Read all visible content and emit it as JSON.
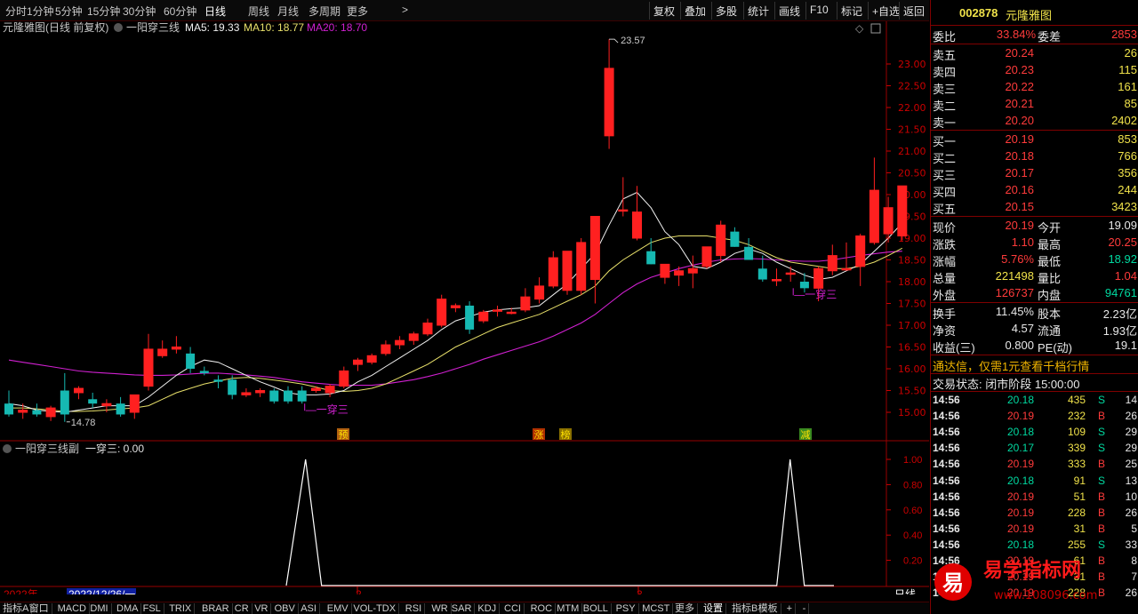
{
  "toolbar": {
    "periods": [
      "分时",
      "1分钟",
      "5分钟",
      "15分钟",
      "30分钟",
      "60分钟",
      "日线",
      "周线",
      "月线",
      "多周期",
      "更多"
    ],
    "active_period": "日线",
    "right_buttons": [
      "复权",
      "叠加",
      "多股",
      "统计",
      "画线",
      "F10",
      "标记",
      "+自选",
      "返回"
    ]
  },
  "main_header": {
    "title": "元隆雅图(日线 前复权)",
    "indicator": "一阳穿三线",
    "ma5": "MA5: 19.33",
    "ma10": "MA10: 18.77",
    "ma20": "MA20: 18.70"
  },
  "sub_header": {
    "title": "一阳穿三线副",
    "value": "一穿三: 0.00"
  },
  "chart_data": {
    "type": "candlestick",
    "y_axis_ticks": [
      "23.00",
      "22.50",
      "22.00",
      "21.50",
      "21.00",
      "20.50",
      "20.00",
      "19.50",
      "19.00",
      "18.50",
      "18.00",
      "17.50",
      "17.00",
      "16.50",
      "16.00",
      "15.50",
      "15.00"
    ],
    "ylim": [
      14.6,
      24.0
    ],
    "candles": [
      [
        15.2,
        15.5,
        14.9,
        14.95
      ],
      [
        15.0,
        15.2,
        14.85,
        15.05
      ],
      [
        15.05,
        15.2,
        14.9,
        14.95
      ],
      [
        14.9,
        15.15,
        14.8,
        15.1
      ],
      [
        15.5,
        15.9,
        14.78,
        14.95
      ],
      [
        15.45,
        15.6,
        15.3,
        15.55
      ],
      [
        15.3,
        15.45,
        15.1,
        15.2
      ],
      [
        15.15,
        15.3,
        15.0,
        15.2
      ],
      [
        15.2,
        15.35,
        14.9,
        14.95
      ],
      [
        15.0,
        15.3,
        14.85,
        15.4
      ],
      [
        15.6,
        16.8,
        15.5,
        16.45
      ],
      [
        16.3,
        16.65,
        16.25,
        16.45
      ],
      [
        16.45,
        16.75,
        16.35,
        16.5
      ],
      [
        16.35,
        16.5,
        15.9,
        16.0
      ],
      [
        15.95,
        16.05,
        15.85,
        15.9
      ],
      [
        15.75,
        15.85,
        15.55,
        15.7
      ],
      [
        15.75,
        15.85,
        15.3,
        15.4
      ],
      [
        15.4,
        15.55,
        15.35,
        15.45
      ],
      [
        15.45,
        15.55,
        15.35,
        15.5
      ],
      [
        15.5,
        15.55,
        15.2,
        15.25
      ],
      [
        15.5,
        15.6,
        15.2,
        15.25
      ],
      [
        15.5,
        15.6,
        15.2,
        15.25
      ],
      [
        15.5,
        15.6,
        15.45,
        15.55
      ],
      [
        15.45,
        15.65,
        15.35,
        15.6
      ],
      [
        15.6,
        16.05,
        15.55,
        15.95
      ],
      [
        16.1,
        16.25,
        15.95,
        16.2
      ],
      [
        16.15,
        16.35,
        16.1,
        16.3
      ],
      [
        16.35,
        16.65,
        16.3,
        16.55
      ],
      [
        16.55,
        16.75,
        16.45,
        16.65
      ],
      [
        16.65,
        16.85,
        16.55,
        16.8
      ],
      [
        16.8,
        17.15,
        16.75,
        17.05
      ],
      [
        17.0,
        17.7,
        16.95,
        17.6
      ],
      [
        17.4,
        17.5,
        17.3,
        17.45
      ],
      [
        17.45,
        17.55,
        16.8,
        16.9
      ],
      [
        17.1,
        17.35,
        17.05,
        17.3
      ],
      [
        17.35,
        17.45,
        17.2,
        17.35
      ],
      [
        17.3,
        17.4,
        17.25,
        17.3
      ],
      [
        17.35,
        17.85,
        17.3,
        17.65
      ],
      [
        17.6,
        18.1,
        17.5,
        17.9
      ],
      [
        17.9,
        18.7,
        17.85,
        18.55
      ],
      [
        17.8,
        18.7,
        17.7,
        18.7
      ],
      [
        17.8,
        19.0,
        17.7,
        18.9
      ],
      [
        18.05,
        19.5,
        17.5,
        19.5
      ],
      [
        21.35,
        23.57,
        21.05,
        22.9
      ],
      [
        19.65,
        20.4,
        19.5,
        19.65
      ],
      [
        19.0,
        20.2,
        18.95,
        19.6
      ],
      [
        18.7,
        19.0,
        18.4,
        18.4
      ],
      [
        18.1,
        18.35,
        17.95,
        18.4
      ],
      [
        18.15,
        18.35,
        17.9,
        18.25
      ],
      [
        18.2,
        18.6,
        17.85,
        18.3
      ],
      [
        18.35,
        18.8,
        18.3,
        18.8
      ],
      [
        18.6,
        19.4,
        18.45,
        19.3
      ],
      [
        19.15,
        19.25,
        18.8,
        18.8
      ],
      [
        18.8,
        19.0,
        18.55,
        18.5
      ],
      [
        18.3,
        18.6,
        18.0,
        18.05
      ],
      [
        18.05,
        18.3,
        17.9,
        18.05
      ],
      [
        18.2,
        18.35,
        18.0,
        18.2
      ],
      [
        18.0,
        18.2,
        17.75,
        17.85
      ],
      [
        17.85,
        18.35,
        17.55,
        18.3
      ],
      [
        18.25,
        18.85,
        18.15,
        18.6
      ],
      [
        18.3,
        18.9,
        18.25,
        18.3
      ],
      [
        18.35,
        19.1,
        17.9,
        19.05
      ],
      [
        18.9,
        20.85,
        18.85,
        20.1
      ],
      [
        19.1,
        19.95,
        18.9,
        19.7
      ],
      [
        19.05,
        20.2,
        18.95,
        20.2
      ]
    ],
    "candle_x_start": 10,
    "candle_x_step": 15.7,
    "ma5": [
      15.2,
      15.15,
      15.05,
      15.02,
      15.0,
      15.05,
      15.1,
      15.15,
      15.15,
      15.15,
      15.35,
      15.6,
      15.85,
      16.05,
      16.2,
      16.15,
      16.0,
      15.85,
      15.7,
      15.58,
      15.45,
      15.4,
      15.4,
      15.42,
      15.5,
      15.7,
      15.85,
      16.05,
      16.25,
      16.45,
      16.65,
      16.9,
      17.1,
      17.2,
      17.3,
      17.35,
      17.38,
      17.4,
      17.45,
      17.7,
      17.95,
      18.3,
      18.65,
      19.3,
      19.9,
      20.05,
      19.7,
      19.15,
      18.85,
      18.35,
      18.3,
      18.45,
      18.65,
      18.75,
      18.65,
      18.45,
      18.3,
      18.15,
      18.05,
      18.1,
      18.25,
      18.4,
      18.7,
      19.0,
      19.35
    ],
    "ma10": [
      15.1,
      15.1,
      15.08,
      15.05,
      15.02,
      15.02,
      15.03,
      15.05,
      15.08,
      15.1,
      15.15,
      15.3,
      15.45,
      15.55,
      15.65,
      15.72,
      15.78,
      15.8,
      15.78,
      15.74,
      15.7,
      15.65,
      15.58,
      15.5,
      15.48,
      15.5,
      15.55,
      15.65,
      15.8,
      15.95,
      16.1,
      16.3,
      16.5,
      16.65,
      16.8,
      16.95,
      17.05,
      17.15,
      17.25,
      17.4,
      17.55,
      17.7,
      17.9,
      18.25,
      18.5,
      18.7,
      18.9,
      19.0,
      19.05,
      19.05,
      19.05,
      19.0,
      18.95,
      18.85,
      18.7,
      18.55,
      18.45,
      18.4,
      18.35,
      18.3,
      18.3,
      18.35,
      18.45,
      18.6,
      18.77
    ],
    "ma20": [
      16.2,
      16.15,
      16.1,
      16.05,
      16.0,
      15.95,
      15.92,
      15.9,
      15.88,
      15.86,
      15.85,
      15.85,
      15.86,
      15.88,
      15.9,
      15.9,
      15.88,
      15.86,
      15.83,
      15.8,
      15.75,
      15.7,
      15.67,
      15.64,
      15.62,
      15.62,
      15.62,
      15.65,
      15.7,
      15.75,
      15.82,
      15.9,
      16.0,
      16.1,
      16.22,
      16.32,
      16.42,
      16.52,
      16.62,
      16.75,
      16.9,
      17.05,
      17.25,
      17.5,
      17.75,
      17.95,
      18.1,
      18.2,
      18.3,
      18.38,
      18.45,
      18.5,
      18.52,
      18.53,
      18.52,
      18.5,
      18.48,
      18.47,
      18.47,
      18.5,
      18.55,
      18.6,
      18.64,
      18.68,
      18.7
    ],
    "labels": {
      "high": "23.57",
      "low": "14.78",
      "signal": "一穿三"
    },
    "markers": [
      "预",
      "涨",
      "榜",
      "减"
    ],
    "sub_ticks": [
      "1.00",
      "0.80",
      "0.60",
      "0.40",
      "0.20"
    ],
    "sub_signal_index": [
      21,
      56
    ],
    "x_axis_labels": [
      "2022年",
      "2022/12/26/一",
      "2",
      "3",
      "日线"
    ]
  },
  "quote": {
    "code": "002878",
    "name": "元隆雅图",
    "weibi_label": "委比",
    "weibi": "33.84%",
    "weicha_label": "委差",
    "weicha": "2853",
    "sells": [
      {
        "label": "卖五",
        "price": "20.24",
        "vol": "26"
      },
      {
        "label": "卖四",
        "price": "20.23",
        "vol": "115"
      },
      {
        "label": "卖三",
        "price": "20.22",
        "vol": "161"
      },
      {
        "label": "卖二",
        "price": "20.21",
        "vol": "85"
      },
      {
        "label": "卖一",
        "price": "20.20",
        "vol": "2402"
      }
    ],
    "buys": [
      {
        "label": "买一",
        "price": "20.19",
        "vol": "853"
      },
      {
        "label": "买二",
        "price": "20.18",
        "vol": "766"
      },
      {
        "label": "买三",
        "price": "20.17",
        "vol": "356"
      },
      {
        "label": "买四",
        "price": "20.16",
        "vol": "244"
      },
      {
        "label": "买五",
        "price": "20.15",
        "vol": "3423"
      }
    ],
    "stats": [
      {
        "l1": "现价",
        "v1": "20.19",
        "c1": "red",
        "l2": "今开",
        "v2": "19.09",
        "c2": "white"
      },
      {
        "l1": "涨跌",
        "v1": "1.10",
        "c1": "red",
        "l2": "最高",
        "v2": "20.25",
        "c2": "red"
      },
      {
        "l1": "涨幅",
        "v1": "5.76%",
        "c1": "red",
        "l2": "最低",
        "v2": "18.92",
        "c2": "grn"
      },
      {
        "l1": "总量",
        "v1": "221498",
        "c1": "yel",
        "l2": "量比",
        "v2": "1.04",
        "c2": "red"
      },
      {
        "l1": "外盘",
        "v1": "126737",
        "c1": "red",
        "l2": "内盘",
        "v2": "94761",
        "c2": "grn"
      }
    ],
    "stats2": [
      {
        "l1": "换手",
        "v1": "11.45%",
        "l2": "股本",
        "v2": "2.23亿"
      },
      {
        "l1": "净资",
        "v1": "4.57",
        "l2": "流通",
        "v2": "1.93亿"
      },
      {
        "l1": "收益(三)",
        "v1": "0.800",
        "l2": "PE(动)",
        "v2": "19.1"
      }
    ],
    "promo": "通达信，仅需1元查看千档行情",
    "status": "交易状态: 闭市阶段 15:00:00",
    "ticks": [
      {
        "t": "14:56",
        "p": "20.18",
        "v": "435",
        "s": "S",
        "n": "14"
      },
      {
        "t": "14:56",
        "p": "20.19",
        "v": "232",
        "s": "B",
        "n": "26"
      },
      {
        "t": "14:56",
        "p": "20.18",
        "v": "109",
        "s": "S",
        "n": "29"
      },
      {
        "t": "14:56",
        "p": "20.17",
        "v": "339",
        "s": "S",
        "n": "29"
      },
      {
        "t": "14:56",
        "p": "20.19",
        "v": "333",
        "s": "B",
        "n": "25"
      },
      {
        "t": "14:56",
        "p": "20.18",
        "v": "91",
        "s": "S",
        "n": "13"
      },
      {
        "t": "14:56",
        "p": "20.19",
        "v": "51",
        "s": "B",
        "n": "10"
      },
      {
        "t": "14:56",
        "p": "20.19",
        "v": "228",
        "s": "B",
        "n": "26"
      },
      {
        "t": "14:56",
        "p": "20.19",
        "v": "31",
        "s": "B",
        "n": "5"
      },
      {
        "t": "14:56",
        "p": "20.18",
        "v": "255",
        "s": "S",
        "n": "33"
      },
      {
        "t": "14:56",
        "p": "20.19",
        "v": "61",
        "s": "B",
        "n": "8"
      },
      {
        "t": "14:56",
        "p": "20.19",
        "v": "31",
        "s": "B",
        "n": "7"
      },
      {
        "t": "14:56",
        "p": "20.19",
        "v": "228",
        "s": "B",
        "n": "26"
      }
    ]
  },
  "bottom_tabs": [
    "指标A",
    "窗口",
    "MACD",
    "DMI",
    "DMA",
    "FSL",
    "TRIX",
    "BRAR",
    "CR",
    "VR",
    "OBV",
    "ASI",
    "EMV",
    "VOL-TDX",
    "RSI",
    "WR",
    "SAR",
    "KDJ",
    "CCI",
    "ROC",
    "MTM",
    "BOLL",
    "PSY",
    "MCST",
    "更多",
    "设置",
    "指标B",
    "模板",
    "+",
    "-"
  ],
  "watermark": {
    "text": "易学指标网",
    "url": "www.108096.com",
    "logo": "易"
  }
}
